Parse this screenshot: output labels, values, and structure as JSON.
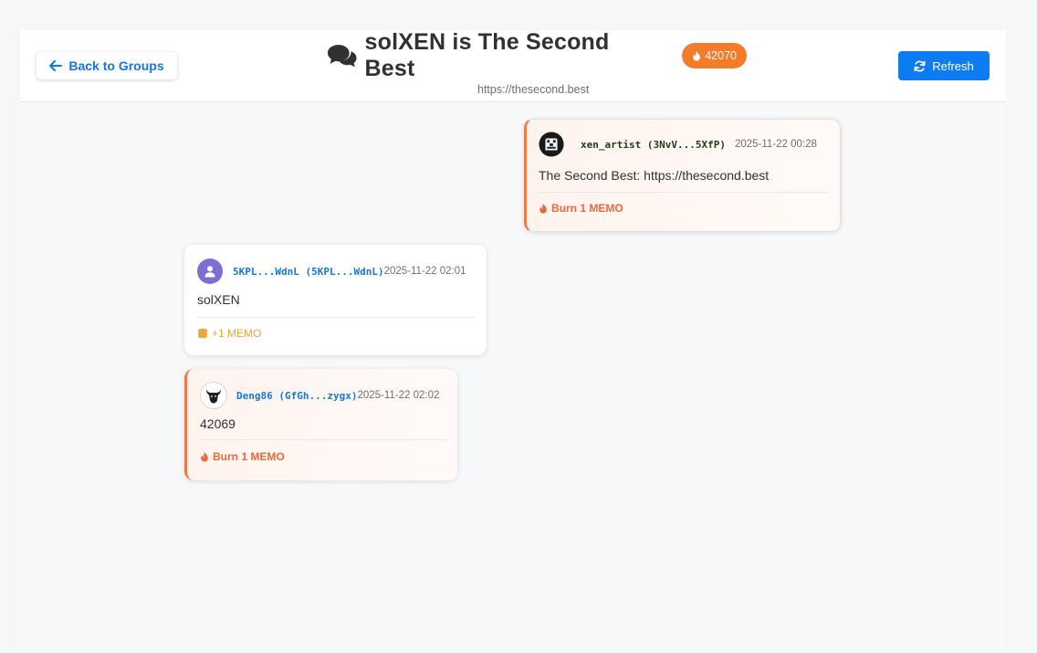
{
  "header": {
    "back_label": "Back to Groups",
    "title": "solXEN is The Second Best",
    "burn_count": "42070",
    "url": "https://thesecond.best",
    "refresh_label": "Refresh"
  },
  "colors": {
    "accent": "#1677d6",
    "burn": "#f47b2a",
    "refresh": "#0d7bf2"
  },
  "messages": [
    {
      "user": "xen_artist (3NvV...5XfP)",
      "time": "2025-11-22 00:28",
      "text": "The Second Best: https://thesecond.best",
      "action": "Burn 1 MEMO",
      "type": "burn",
      "avatar_icon": "pixel-face-icon"
    },
    {
      "user": "5KPL...WdnL (5KPL...WdnL)",
      "time": "2025-11-22 02:01",
      "text": "solXEN",
      "action": "+1 MEMO",
      "type": "reward",
      "avatar_icon": "user-icon"
    },
    {
      "user": "Deng86 (GfGh...zygx)",
      "time": "2025-11-22 02:02",
      "text": "42069",
      "action": "Burn 1 MEMO",
      "type": "burn",
      "avatar_icon": "bull-icon"
    }
  ]
}
